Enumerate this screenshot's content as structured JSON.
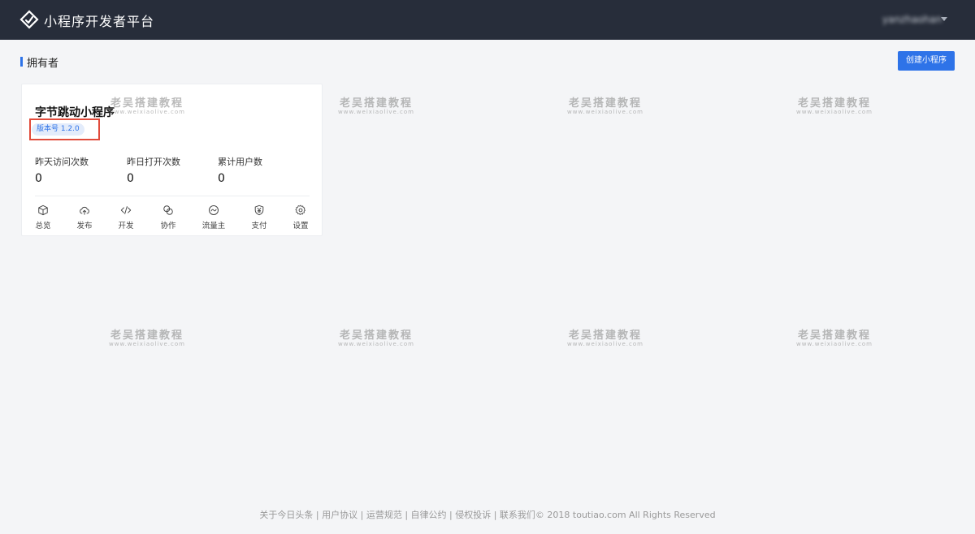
{
  "header": {
    "app_title": "小程序开发者平台",
    "user_name": "yanzhaohan"
  },
  "section": {
    "title": "拥有者",
    "create_button": "创建小程序"
  },
  "card": {
    "name": "字节跳动小程序",
    "version": "版本号 1.2.0",
    "stats": [
      {
        "label": "昨天访问次数",
        "value": "0"
      },
      {
        "label": "昨日打开次数",
        "value": "0"
      },
      {
        "label": "累计用户数",
        "value": "0"
      }
    ],
    "actions": [
      {
        "label": "总览",
        "icon": "cube-icon"
      },
      {
        "label": "发布",
        "icon": "cloud-upload-icon"
      },
      {
        "label": "开发",
        "icon": "code-icon"
      },
      {
        "label": "协作",
        "icon": "collaborate-icon"
      },
      {
        "label": "流量主",
        "icon": "traffic-icon"
      },
      {
        "label": "支付",
        "icon": "yen-shield-icon"
      },
      {
        "label": "设置",
        "icon": "gear-icon"
      }
    ]
  },
  "watermark": {
    "main": "老吴搭建教程",
    "sub": "www.weixiaolive.com"
  },
  "footer": {
    "text": "关于今日头条 | 用户协议 | 运营规范 | 自律公约 | 侵权投诉 | 联系我们© 2018 toutiao.com All Rights Reserved"
  },
  "colors": {
    "topbar": "#272d3a",
    "accent": "#2e73e8",
    "highlight_box": "#e14b3b"
  }
}
